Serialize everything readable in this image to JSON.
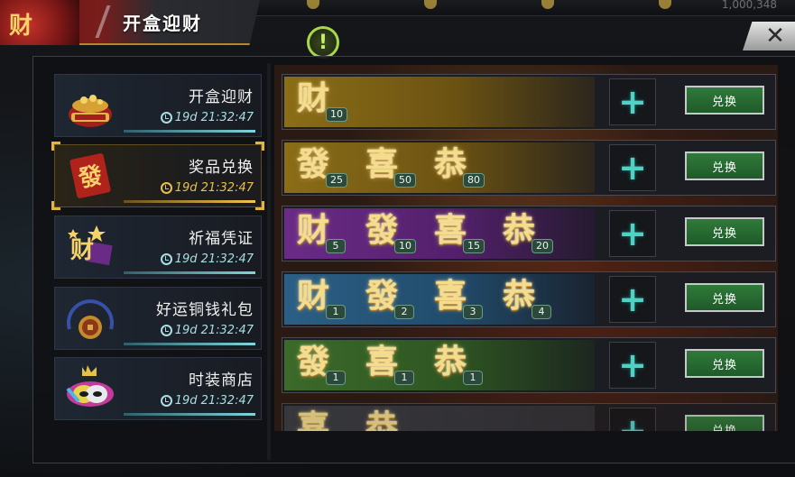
{
  "header": {
    "title": "开盒迎财",
    "badge_text": "财",
    "top_number": "1,000,348"
  },
  "close_label": "✕",
  "warning_label": "!",
  "sidebar": {
    "items": [
      {
        "label": "开盒迎财",
        "timer": "19d 21:32:47",
        "icon": "gift-pot-icon",
        "active": false
      },
      {
        "label": "奖品兑换",
        "timer": "19d 21:32:47",
        "icon": "fa-card-icon",
        "active": true
      },
      {
        "label": "祈福凭证",
        "timer": "19d 21:32:47",
        "icon": "cai-star-icon",
        "active": false
      },
      {
        "label": "好运铜钱礼包",
        "timer": "19d 21:32:47",
        "icon": "coin-dial-icon",
        "active": false
      },
      {
        "label": "时装商店",
        "timer": "19d 21:32:47",
        "icon": "crown-mask-icon",
        "active": false
      }
    ]
  },
  "exchange_label": "兑换",
  "plus_label": "+",
  "rows": [
    {
      "theme": "gold",
      "items": [
        {
          "char": "财",
          "count": "10"
        }
      ]
    },
    {
      "theme": "gold",
      "items": [
        {
          "char": "發",
          "count": "25"
        },
        {
          "char": "喜",
          "count": "50"
        },
        {
          "char": "恭",
          "count": "80"
        }
      ]
    },
    {
      "theme": "purple",
      "items": [
        {
          "char": "财",
          "count": "5"
        },
        {
          "char": "發",
          "count": "10"
        },
        {
          "char": "喜",
          "count": "15"
        },
        {
          "char": "恭",
          "count": "20"
        }
      ]
    },
    {
      "theme": "blue",
      "items": [
        {
          "char": "财",
          "count": "1"
        },
        {
          "char": "發",
          "count": "2"
        },
        {
          "char": "喜",
          "count": "3"
        },
        {
          "char": "恭",
          "count": "4"
        }
      ]
    },
    {
      "theme": "green",
      "items": [
        {
          "char": "發",
          "count": "1"
        },
        {
          "char": "喜",
          "count": "1"
        },
        {
          "char": "恭",
          "count": "1"
        }
      ]
    },
    {
      "theme": "grey",
      "items": [
        {
          "char": "喜",
          "count": ""
        },
        {
          "char": "恭",
          "count": ""
        }
      ]
    }
  ],
  "colors": {
    "accent_gold": "#e4b43b",
    "plus_teal": "#4fd2c4",
    "exchange_green": "#2f7a3a",
    "timer_cyan": "#a9dfe2"
  }
}
